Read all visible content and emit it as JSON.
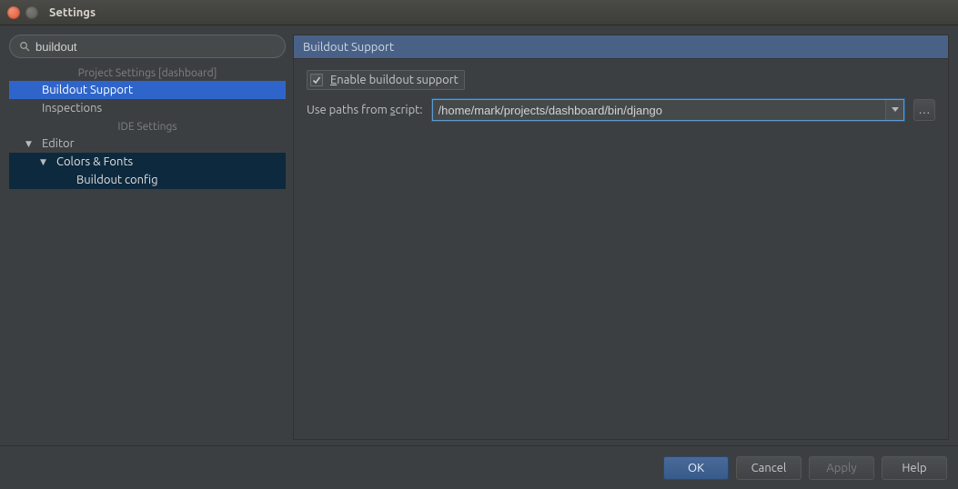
{
  "window": {
    "title": "Settings"
  },
  "search": {
    "value": "buildout"
  },
  "sidebar": {
    "section_project": "Project Settings [dashboard]",
    "item_buildout": "Buildout Support",
    "item_inspections": "Inspections",
    "section_ide": "IDE Settings",
    "item_editor": "Editor",
    "item_colors_fonts": "Colors & Fonts",
    "item_buildout_config": "Buildout config"
  },
  "panel": {
    "title": "Buildout Support",
    "enable_prefix": "E",
    "enable_rest": "nable buildout support",
    "paths_prefix": "Use paths from ",
    "paths_mn": "s",
    "paths_rest": "cript:",
    "script_path": "/home/mark/projects/dashboard/bin/django",
    "browse_glyph": "…"
  },
  "buttons": {
    "ok": "OK",
    "cancel": "Cancel",
    "apply": "Apply",
    "help": "Help"
  }
}
